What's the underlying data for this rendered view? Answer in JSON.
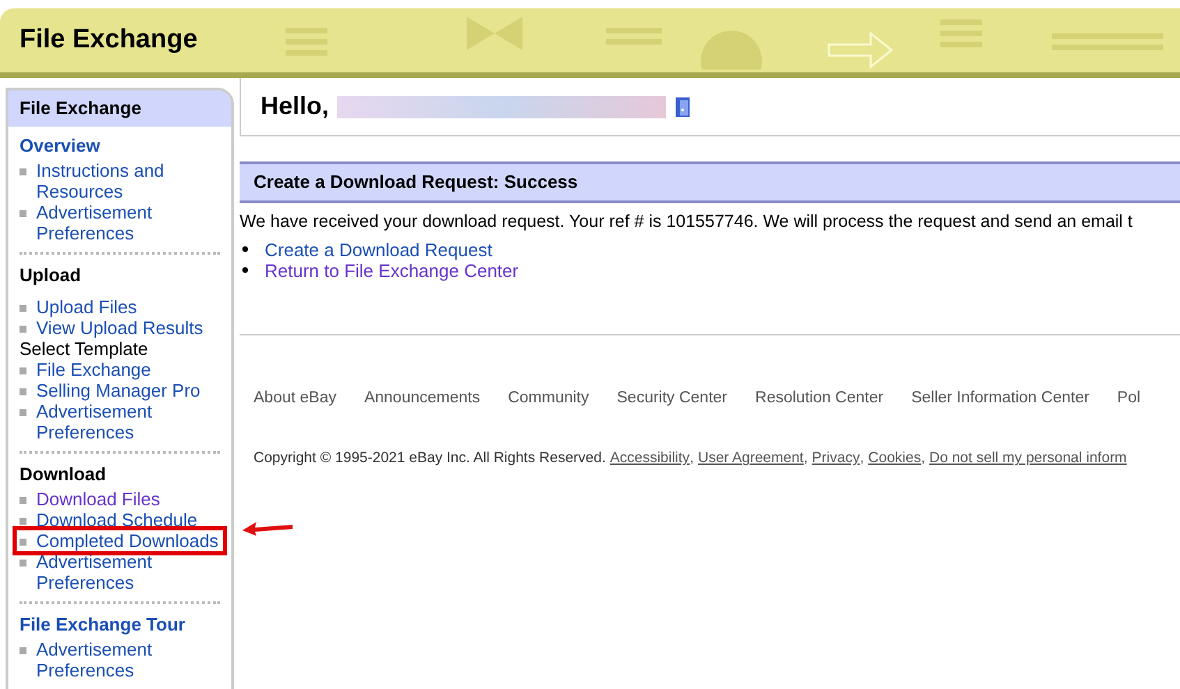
{
  "header": {
    "title": "File Exchange"
  },
  "sidebar": {
    "title": "File Exchange",
    "sections": [
      {
        "title": "Overview",
        "link": true,
        "items": [
          {
            "kind": "link",
            "label": "Instructions and Resources",
            "visited": false,
            "highlighted": false
          },
          {
            "kind": "link",
            "label": "Advertisement Preferences",
            "visited": false,
            "highlighted": false
          }
        ]
      },
      {
        "title": "Upload",
        "link": false,
        "items": [
          {
            "kind": "link",
            "label": "Upload Files",
            "visited": false,
            "highlighted": false
          },
          {
            "kind": "link",
            "label": "View Upload Results",
            "visited": false,
            "highlighted": false
          },
          {
            "kind": "label",
            "label": "Select Template"
          },
          {
            "kind": "link",
            "label": "File Exchange",
            "visited": false,
            "highlighted": false
          },
          {
            "kind": "link",
            "label": "Selling Manager Pro",
            "visited": false,
            "highlighted": false
          },
          {
            "kind": "link",
            "label": "Advertisement Preferences",
            "visited": false,
            "highlighted": false
          }
        ]
      },
      {
        "title": "Download",
        "link": false,
        "items": [
          {
            "kind": "link",
            "label": "Download Files",
            "visited": true,
            "highlighted": false
          },
          {
            "kind": "link",
            "label": "Download Schedule",
            "visited": false,
            "highlighted": false
          },
          {
            "kind": "link",
            "label": "Completed Downloads",
            "visited": false,
            "highlighted": true
          },
          {
            "kind": "link",
            "label": "Advertisement Preferences",
            "visited": false,
            "highlighted": false
          }
        ]
      },
      {
        "title": "File Exchange Tour",
        "link": true,
        "items": [
          {
            "kind": "link",
            "label": "Advertisement Preferences",
            "visited": false,
            "highlighted": false
          }
        ]
      }
    ]
  },
  "greeting": {
    "text": "Hello,"
  },
  "panel": {
    "title": "Create a Download Request: Success",
    "message": "We have received your download request. Your ref # is 101557746. We will process the request and send an email t",
    "links": [
      {
        "label": "Create a Download Request",
        "visited": false
      },
      {
        "label": "Return to File Exchange Center",
        "visited": true
      }
    ]
  },
  "footer": {
    "links": [
      "About eBay",
      "Announcements",
      "Community",
      "Security Center",
      "Resolution Center",
      "Seller Information Center",
      "Pol"
    ],
    "copyright": "Copyright © 1995-2021 eBay Inc. All Rights Reserved.",
    "separator": ",",
    "legal_links": [
      "Accessibility",
      "User Agreement",
      "Privacy",
      "Cookies",
      "Do not sell my personal inform"
    ]
  }
}
